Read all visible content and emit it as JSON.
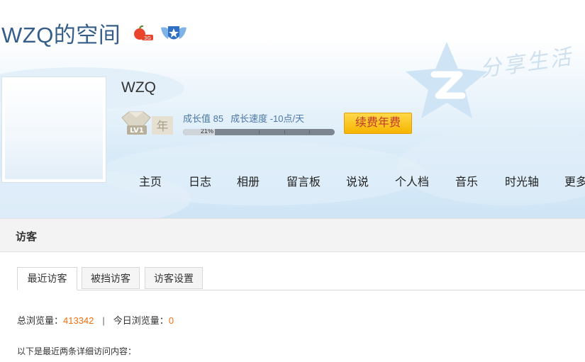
{
  "header": {
    "title": "WZQ的空间",
    "title_icons": [
      "apple-3g-icon",
      "winged-vip-star-icon"
    ],
    "slogan": "分享生活"
  },
  "profile": {
    "username": "WZQ",
    "level_badge": "LV1",
    "level_year": "年",
    "growth_value_text": "成长值 85",
    "growth_speed_text": "成长速度 -10点/天",
    "progress_percent": 21,
    "progress_label": "21%",
    "renew_button": "续费年费"
  },
  "nav": {
    "items": [
      {
        "label": "主页"
      },
      {
        "label": "日志"
      },
      {
        "label": "相册"
      },
      {
        "label": "留言板"
      },
      {
        "label": "说说"
      },
      {
        "label": "个人档"
      },
      {
        "label": "音乐"
      },
      {
        "label": "时光轴"
      },
      {
        "label": "更多"
      }
    ]
  },
  "visitors": {
    "title": "访客",
    "tabs": [
      {
        "label": "最近访客",
        "active": true
      },
      {
        "label": "被挡访客",
        "active": false
      },
      {
        "label": "访客设置",
        "active": false
      }
    ],
    "total_views_label": "总浏览量：",
    "total_views_value": "413342",
    "separator": "|",
    "today_views_label": "今日浏览量：",
    "today_views_value": "0",
    "description": "以下是最近两条详细访问内容："
  },
  "colors": {
    "title": "#355d8a",
    "accent_orange": "#f06f0e",
    "renew_bg": "#f7b500",
    "renew_text": "#c0392b"
  }
}
